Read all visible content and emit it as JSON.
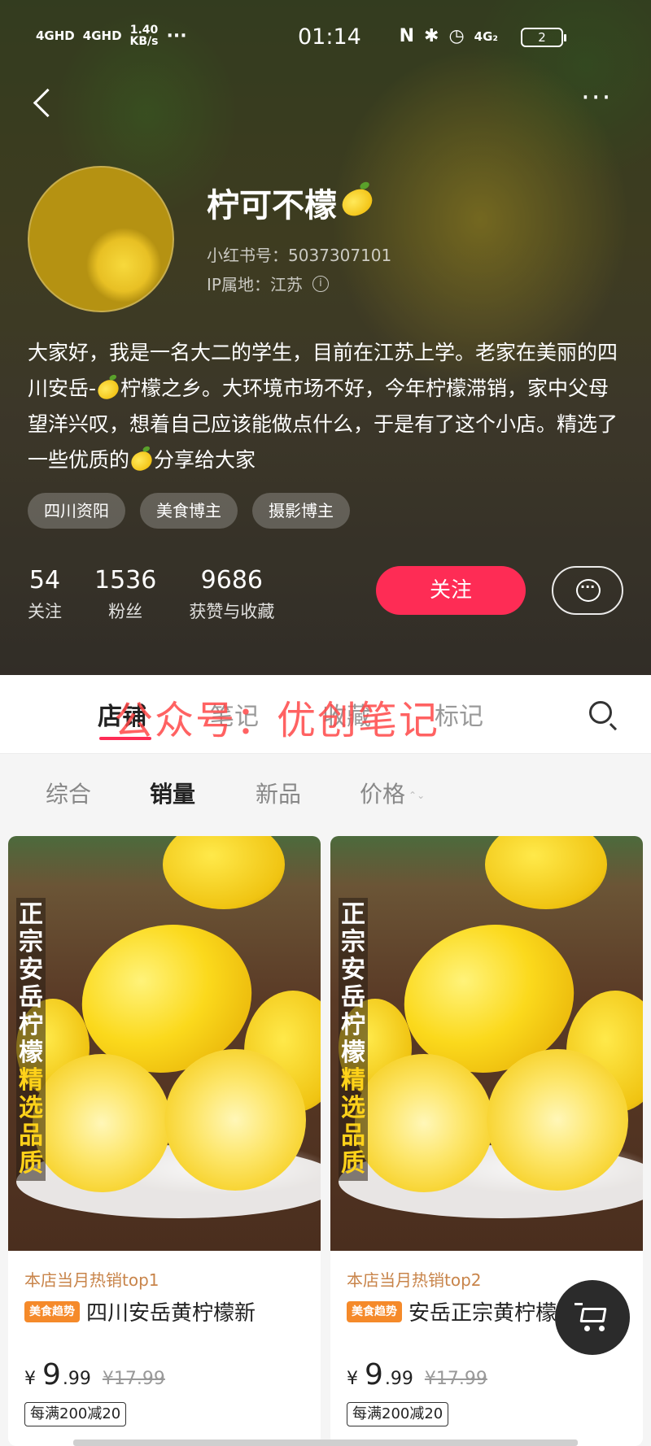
{
  "status_bar": {
    "signal1": "4GHD",
    "signal2": "4GHD",
    "speed": "1.40",
    "speed_unit": "KB/s",
    "dots": "···",
    "time": "01:14",
    "nfc": "N",
    "bluetooth": "✱",
    "alarm": "◷",
    "net": "4G₂",
    "battery": "2"
  },
  "nav": {
    "back_icon": "back-arrow-icon",
    "more_label": "···"
  },
  "profile": {
    "nickname": "柠可不檬",
    "red_id": "小红书号：5037307101",
    "ip_location": "IP属地：江苏",
    "info_icon": "i",
    "bio_parts": [
      "大家好，我是一名大二的学生，目前在江苏上学。老家在美丽的四川安岳-",
      "柠檬之乡。大环境市场不好，今年柠檬滞销，家中父母望洋兴叹，想着自己应该能做点什么，于是有了这个小店。精选了一些优质的",
      "分享给大家"
    ],
    "tags": [
      "四川资阳",
      "美食博主",
      "摄影博主"
    ],
    "stats": [
      {
        "num": "54",
        "label": "关注"
      },
      {
        "num": "1536",
        "label": "粉丝"
      },
      {
        "num": "9686",
        "label": "获赞与收藏"
      }
    ],
    "follow_label": "关注"
  },
  "tabs": [
    "店铺",
    "笔记",
    "收藏",
    "标记"
  ],
  "watermark": "公众号：优创笔记",
  "sort": [
    "综合",
    "销量",
    "新品",
    "价格"
  ],
  "sort_arrows": "⌃⌄",
  "products": [
    {
      "image_text_top": [
        "正",
        "宗",
        "安",
        "岳",
        "柠",
        "檬"
      ],
      "image_text_bottom": [
        "精",
        "选",
        "品",
        "质"
      ],
      "rank": "本店当月热销top1",
      "badge": "美食趋势",
      "name": "四川安岳黄柠檬新",
      "price_symbol": "¥",
      "price_int": "9",
      "price_dec": ".99",
      "price_old": "¥17.99",
      "coupon": "每满200减20"
    },
    {
      "image_text_top": [
        "正",
        "宗",
        "安",
        "岳",
        "柠",
        "檬"
      ],
      "image_text_bottom": [
        "精",
        "选",
        "品",
        "质"
      ],
      "rank": "本店当月热销top2",
      "badge": "美食趋势",
      "name": "安岳正宗黄柠檬",
      "price_symbol": "¥",
      "price_int": "9",
      "price_dec": ".99",
      "price_old": "¥17.99",
      "coupon": "每满200减20"
    }
  ],
  "colors": {
    "accent": "#fe2c55",
    "badge": "#f58a2a",
    "rank": "#c8844a"
  }
}
